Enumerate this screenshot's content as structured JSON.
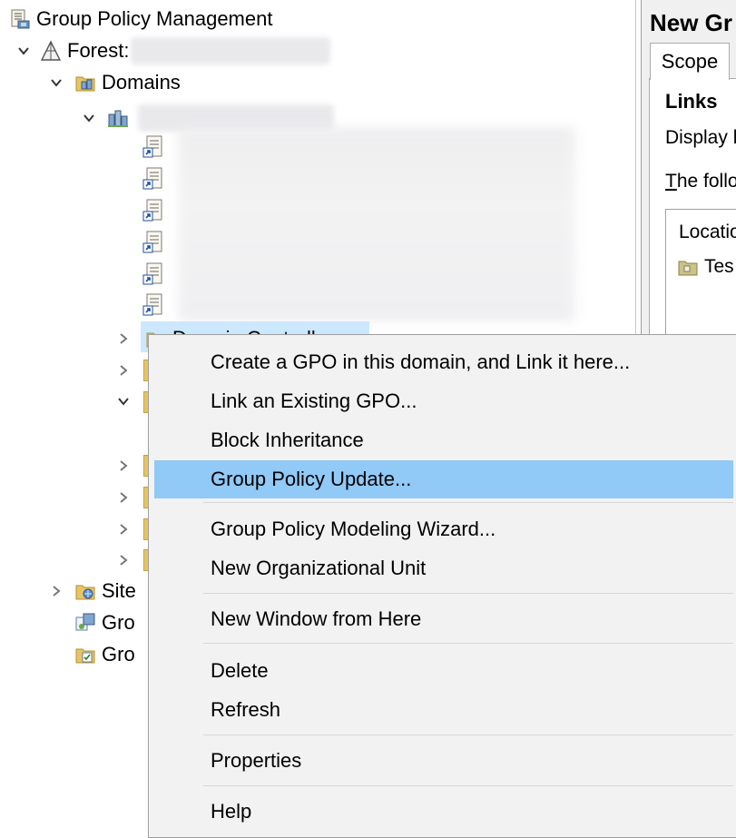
{
  "tree": {
    "root_label": "Group Policy Management",
    "forest_label": "Forest:",
    "domains_label": "Domains",
    "domain_controllers_label": "Domain Controllers",
    "sites_label_partial": "Site",
    "group_policy_modeling_partial": "Gro",
    "group_policy_results_partial": "Gro"
  },
  "right_pane": {
    "title": "New Gr",
    "scope_tab": "Scope",
    "links_heading": "Links",
    "display_label": "Display li",
    "following_label_underlined": "T",
    "following_label_rest": "he follo",
    "location_header": "Locatio",
    "location_row": "Tes"
  },
  "context_menu": {
    "items": [
      "Create a GPO in this domain, and Link it here...",
      "Link an Existing GPO...",
      "Block Inheritance",
      "Group Policy Update...",
      "Group Policy Modeling Wizard...",
      "New Organizational Unit",
      "New Window from Here",
      "Delete",
      "Refresh",
      "Properties",
      "Help"
    ],
    "highlighted_item": "Group Policy Update...",
    "highlight_color": "#91c9f7"
  },
  "colors": {
    "selection": "#cce8ff",
    "menu_background": "#f2f2f2",
    "folder_yellow": "#e7c567"
  }
}
